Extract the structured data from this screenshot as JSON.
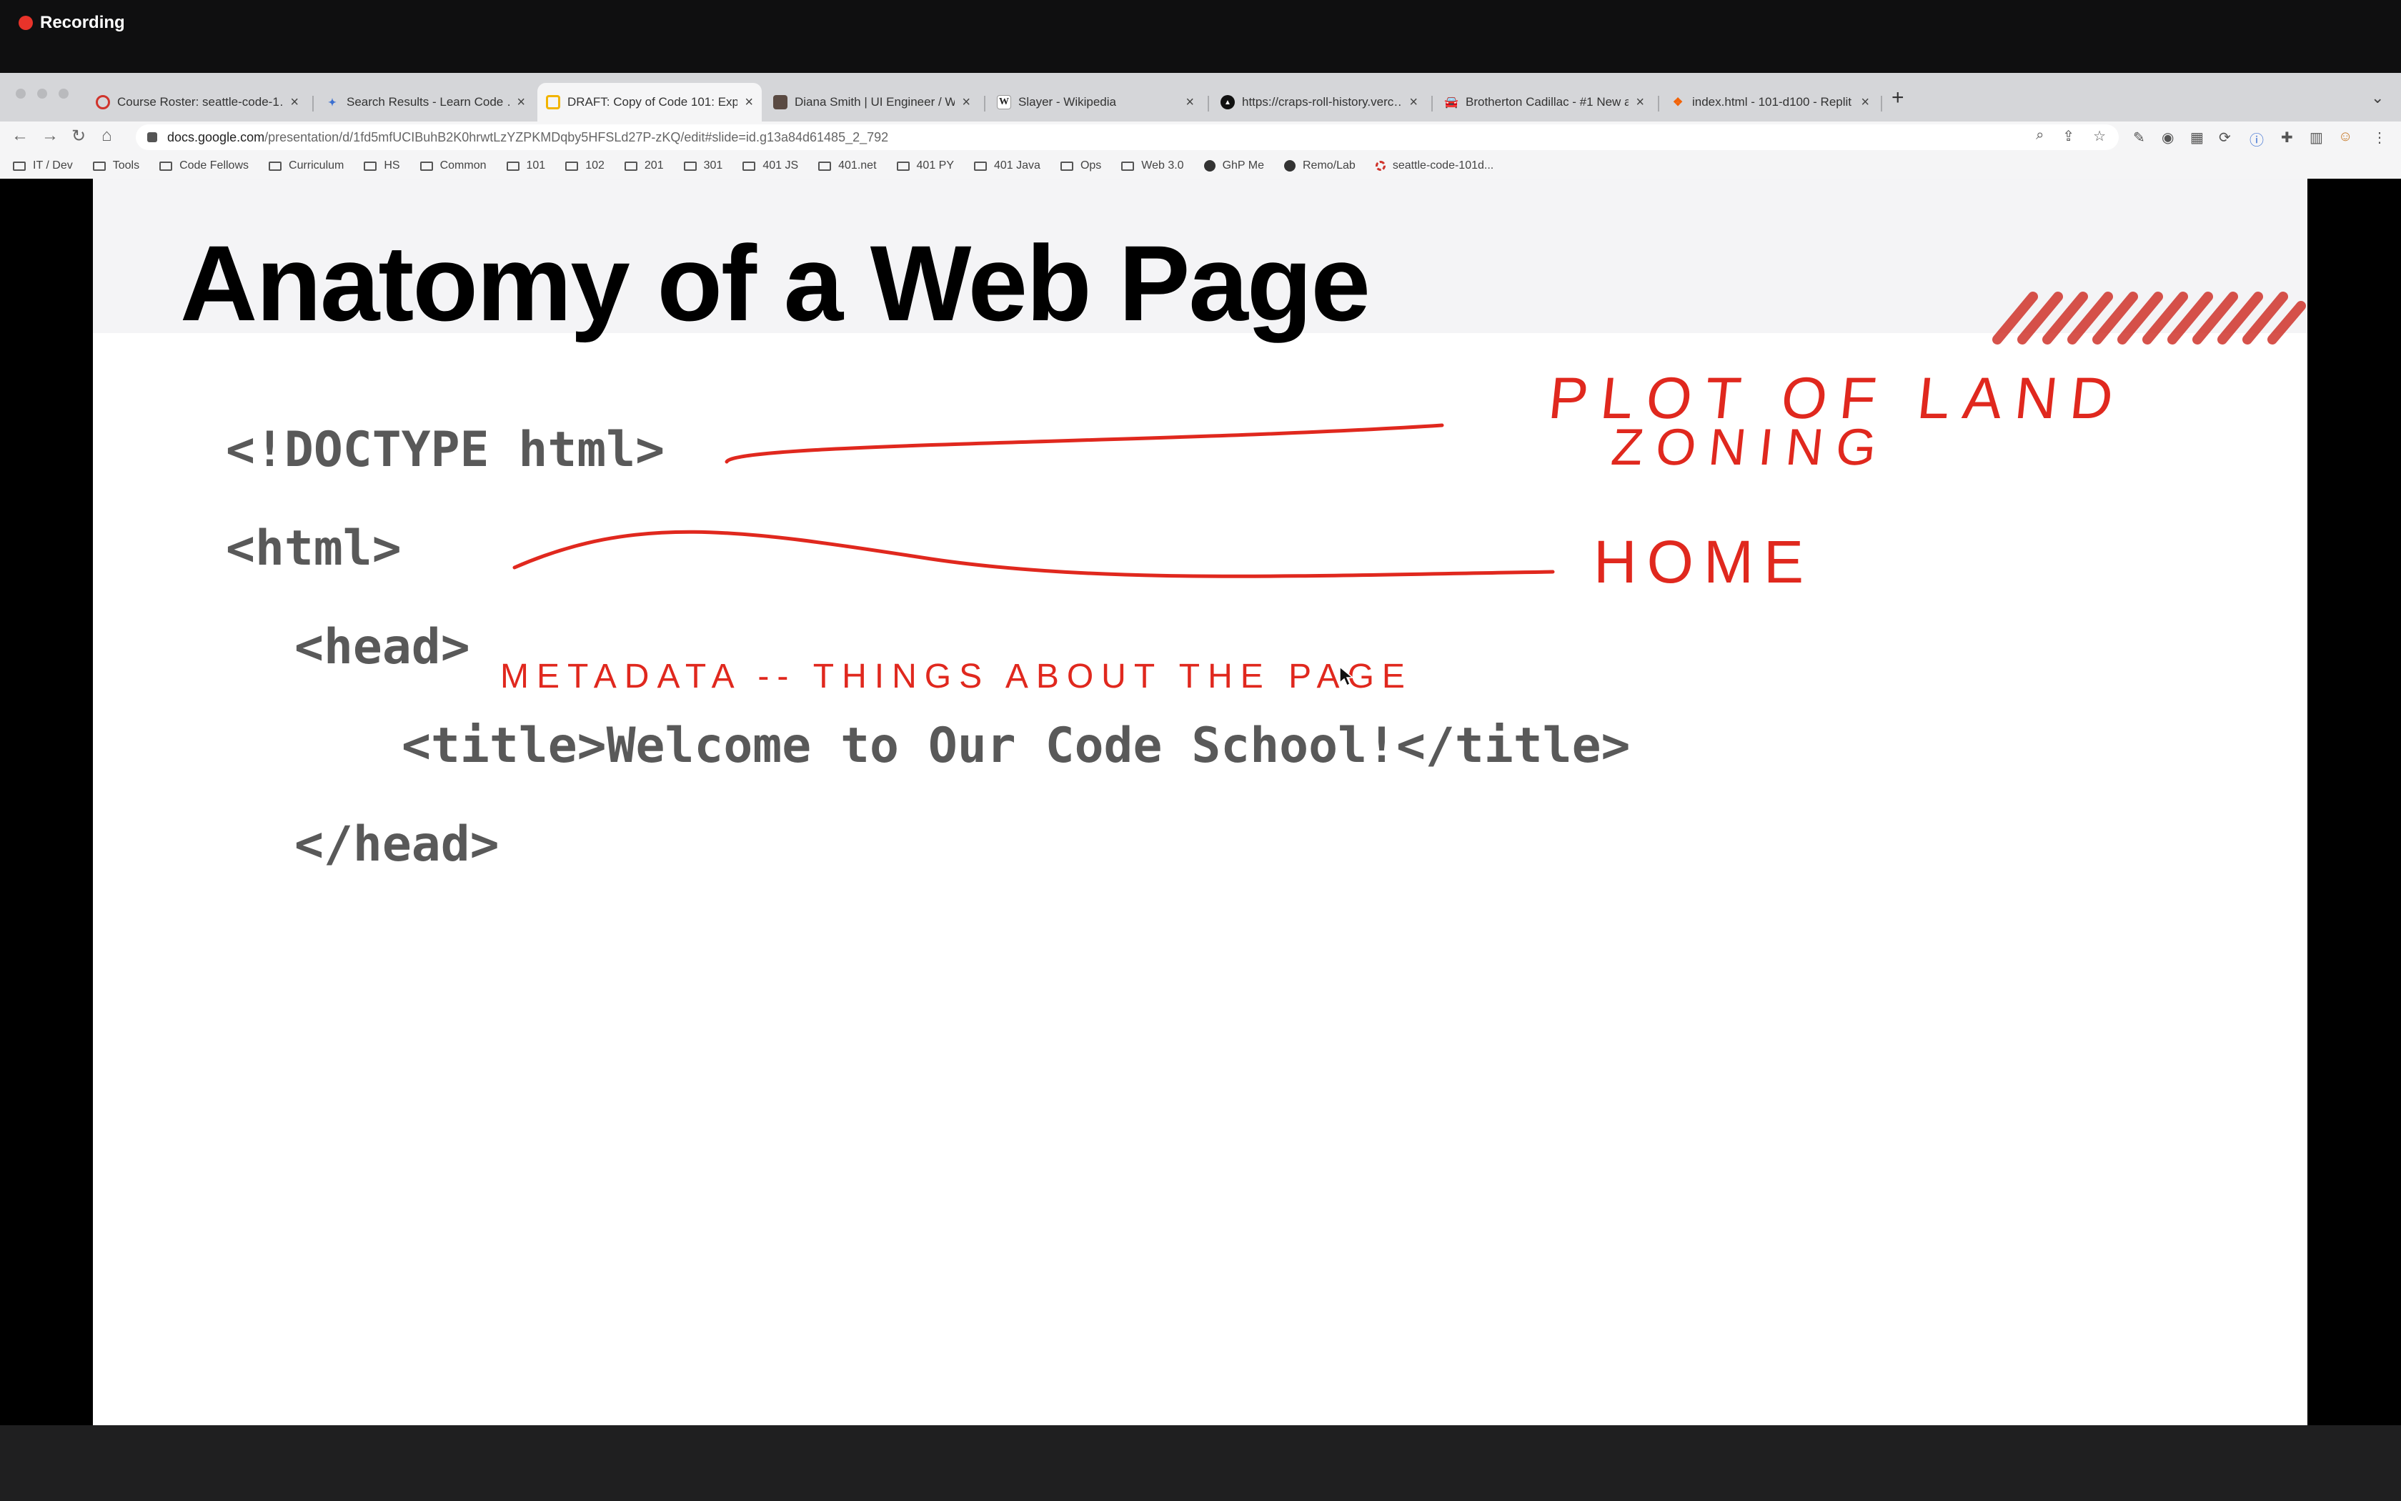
{
  "recording": {
    "label": "Recording"
  },
  "tabs": [
    {
      "label": "Course Roster: seattle-code-1…",
      "icon": "canvas-icon",
      "active": false
    },
    {
      "label": "Search Results - Learn Code …",
      "icon": "codefellows-icon",
      "active": false
    },
    {
      "label": "DRAFT: Copy of Code 101: Exp…",
      "icon": "slides-icon",
      "active": true
    },
    {
      "label": "Diana Smith | UI Engineer / We…",
      "icon": "profile-icon",
      "active": false
    },
    {
      "label": "Slayer - Wikipedia",
      "icon": "wikipedia-icon",
      "active": false
    },
    {
      "label": "https://craps-roll-history.verc…",
      "icon": "vercel-icon",
      "active": false
    },
    {
      "label": "Brotherton Cadillac - #1 New a…",
      "icon": "car-icon",
      "active": false
    },
    {
      "label": "index.html - 101-d100 - Replit",
      "icon": "replit-icon",
      "active": false
    }
  ],
  "address": {
    "host": "docs.google.com",
    "path": "/presentation/d/1fd5mfUCIBuhB2K0hrwtLzYZPKMDqby5HFSLd27P-zKQ/edit#slide=id.g13a84d61485_2_792"
  },
  "bookmarks": [
    {
      "label": "IT / Dev",
      "kind": "folder"
    },
    {
      "label": "Tools",
      "kind": "folder"
    },
    {
      "label": "Code Fellows",
      "kind": "folder"
    },
    {
      "label": "Curriculum",
      "kind": "folder"
    },
    {
      "label": "HS",
      "kind": "folder"
    },
    {
      "label": "Common",
      "kind": "folder"
    },
    {
      "label": "101",
      "kind": "folder"
    },
    {
      "label": "102",
      "kind": "folder"
    },
    {
      "label": "201",
      "kind": "folder"
    },
    {
      "label": "301",
      "kind": "folder"
    },
    {
      "label": "401 JS",
      "kind": "folder"
    },
    {
      "label": "401.net",
      "kind": "folder"
    },
    {
      "label": "401 PY",
      "kind": "folder"
    },
    {
      "label": "401 Java",
      "kind": "folder"
    },
    {
      "label": "Ops",
      "kind": "folder"
    },
    {
      "label": "Web 3.0",
      "kind": "folder"
    },
    {
      "label": "GhP Me",
      "kind": "globe"
    },
    {
      "label": "Remo/Lab",
      "kind": "globe"
    },
    {
      "label": "seattle-code-101d...",
      "kind": "ring"
    }
  ],
  "slide": {
    "title": "Anatomy of a Web Page",
    "code_lines": [
      "<!DOCTYPE html>",
      "<html>",
      "<head>",
      "<title>Welcome to Our Code School!</title>",
      "</head>"
    ],
    "annotations": {
      "doctype_line1": "PLOT OF LAND",
      "doctype_line2": "ZONING",
      "html": "HOME",
      "head": "METADATA -- THINGS ABOUT THE PAGE"
    }
  },
  "colors": {
    "ink": "#e0281e",
    "recording": "#e8332a"
  }
}
